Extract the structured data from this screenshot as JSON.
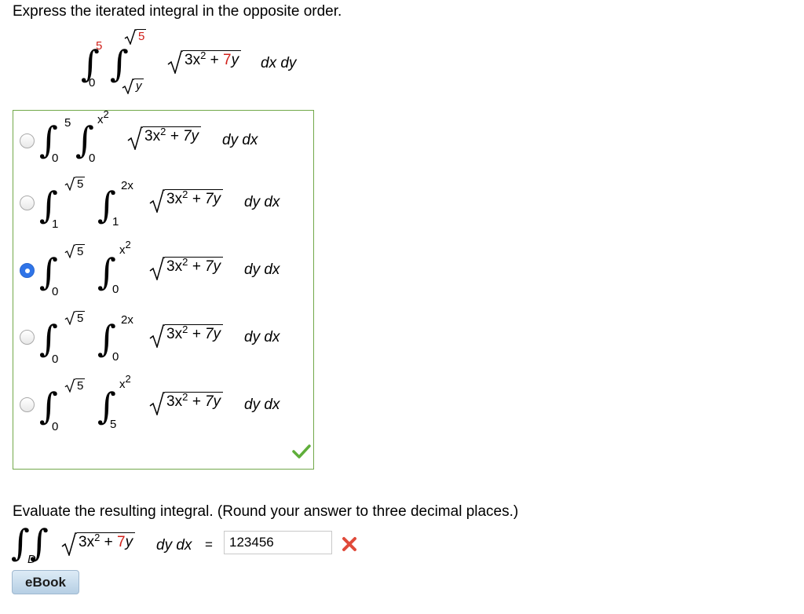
{
  "question1": {
    "prompt": "Express the iterated integral in the opposite order.",
    "given": {
      "outer_upper": "5",
      "outer_lower": "0",
      "inner_upper": "5",
      "inner_lower": "y",
      "radicand_a": "3x",
      "radicand_exp": "2",
      "radicand_plus": "+",
      "radicand_coef": "7",
      "radicand_var": "y",
      "order": "dx dy"
    }
  },
  "options": [
    {
      "outer_upper": "5",
      "outer_lower": "0",
      "inner_upper": "x",
      "inner_upper_exp": "2",
      "inner_lower": "0",
      "radicand": "3x",
      "radicand_exp": "2",
      "radicand_rest": "+ 7y",
      "order": "dy dx",
      "selected": false
    },
    {
      "outer_upper": "5",
      "outer_lower": "1",
      "inner_upper": "2x",
      "inner_upper_exp": "",
      "inner_lower": "1",
      "radicand": "3x",
      "radicand_exp": "2",
      "radicand_rest": "+ 7y",
      "order": "dy dx",
      "selected": false
    },
    {
      "outer_upper": "5",
      "outer_lower": "0",
      "inner_upper": "x",
      "inner_upper_exp": "2",
      "inner_lower": "0",
      "radicand": "3x",
      "radicand_exp": "2",
      "radicand_rest": "+ 7y",
      "order": "dy dx",
      "selected": true
    },
    {
      "outer_upper": "5",
      "outer_lower": "0",
      "inner_upper": "2x",
      "inner_upper_exp": "",
      "inner_lower": "0",
      "radicand": "3x",
      "radicand_exp": "2",
      "radicand_rest": "+ 7y",
      "order": "dy dx",
      "selected": false
    },
    {
      "outer_upper": "5",
      "outer_lower": "0",
      "inner_upper": "x",
      "inner_upper_exp": "2",
      "inner_lower": "5",
      "radicand": "3x",
      "radicand_exp": "2",
      "radicand_rest": "+ 7y",
      "order": "dy dx",
      "selected": false
    }
  ],
  "question2": {
    "prompt": "Evaluate the resulting integral. (Round your answer to three decimal places.)",
    "region": "D",
    "radicand_a": "3x",
    "radicand_exp": "2",
    "radicand_plus": "+",
    "radicand_coef": "7",
    "radicand_var": "y",
    "order": "dy dx",
    "equals": "=",
    "answer_value": "123456"
  },
  "status": {
    "q1_correct_icon": "checkmark-icon",
    "q2_incorrect_icon": "x-mark-icon",
    "accent_red": "#d0201a",
    "accent_green": "#72a84a",
    "radio_selected_color": "#2f74e8"
  },
  "ebook_label": "eBook"
}
